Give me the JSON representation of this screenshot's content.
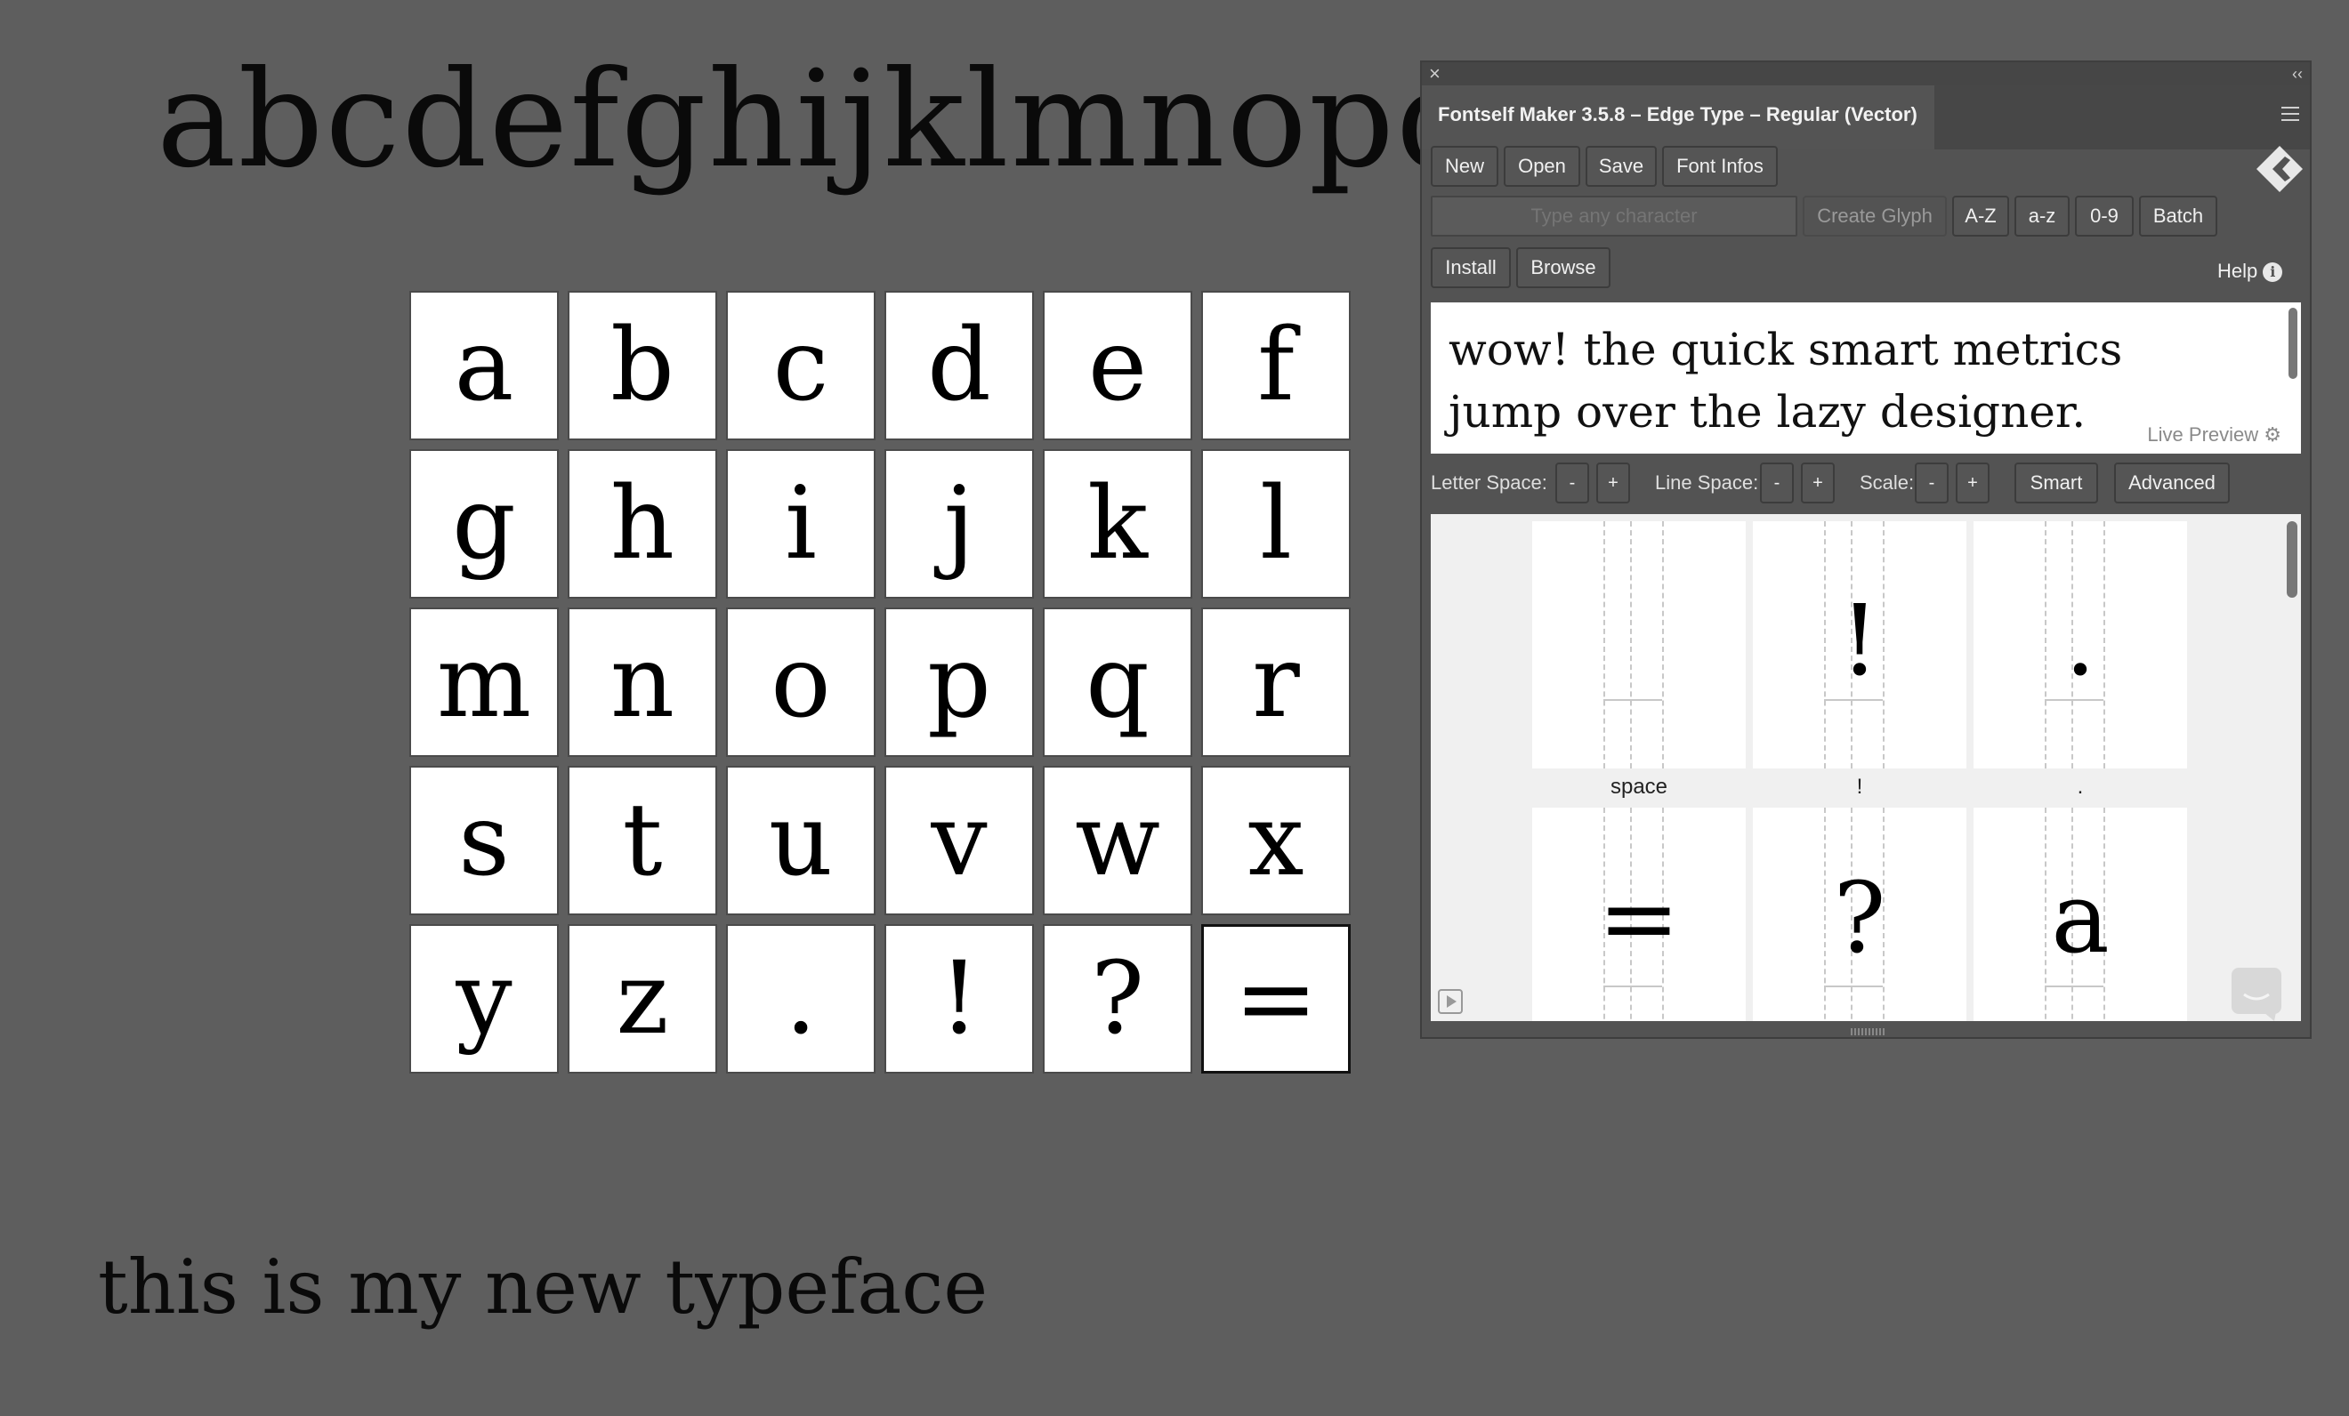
{
  "canvas": {
    "alphabet_line": "abcdefghijklmnopqrstuv",
    "grid_glyphs": [
      "a",
      "b",
      "c",
      "d",
      "e",
      "f",
      "g",
      "h",
      "i",
      "j",
      "k",
      "l",
      "m",
      "n",
      "o",
      "p",
      "q",
      "r",
      "s",
      "t",
      "u",
      "v",
      "w",
      "x",
      "y",
      "z",
      ".",
      "!",
      "?",
      "="
    ],
    "selected_glyph_index": 29,
    "sample_line": "this is my new typeface"
  },
  "panel": {
    "title": "Fontself Maker 3.5.8 – Edge Type – Regular (Vector)",
    "buttons": {
      "new": "New",
      "open": "Open",
      "save": "Save",
      "font_infos": "Font Infos",
      "create_glyph": "Create Glyph",
      "az_upper": "A-Z",
      "az_lower": "a-z",
      "digits": "0-9",
      "batch": "Batch",
      "install": "Install",
      "browse": "Browse",
      "smart": "Smart",
      "advanced": "Advanced",
      "minus": "-",
      "plus": "+"
    },
    "char_input_placeholder": "Type any character",
    "help_label": "Help",
    "preview": {
      "text": "wow! the quick smart metrics jump over the lazy designer.",
      "label": "Live Preview"
    },
    "metrics": {
      "letter_space": "Letter Space:",
      "line_space": "Line Space:",
      "scale": "Scale:"
    },
    "glyph_list": [
      {
        "glyph": "",
        "caption": "space"
      },
      {
        "glyph": "!",
        "caption": "!"
      },
      {
        "glyph": ".",
        "caption": "."
      },
      {
        "glyph": "=",
        "caption": ""
      },
      {
        "glyph": "?",
        "caption": ""
      },
      {
        "glyph": "a",
        "caption": ""
      }
    ]
  },
  "colors": {
    "workspace": "#5e5e5e",
    "panel": "#535353",
    "tab": "#545454"
  },
  "icons": [
    "close-icon",
    "collapse-icon",
    "menu-icon",
    "fontself-logo-icon",
    "info-icon",
    "gear-icon",
    "play-icon",
    "chat-icon"
  ]
}
